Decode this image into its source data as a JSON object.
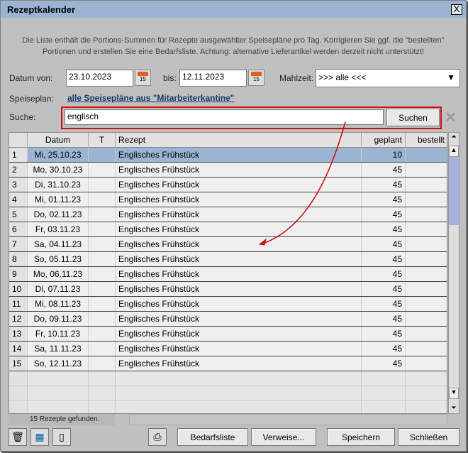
{
  "window": {
    "title": "Rezeptkalender",
    "close_label": "X"
  },
  "info": {
    "line1": "Die Liste enthält die Portions-Summen für Rezepte ausgewählter Speisepläne pro Tag. Korrigieren Sie ggf. die \"bestellten\"",
    "line2": "Portionen und erstellen Sie eine Bedarfsliste. Achtung: alternative Lieferartikel werden derzeit nicht unterstützt!"
  },
  "filter": {
    "von_label": "Datum von:",
    "von_value": "23.10.2023",
    "bis_label": "bis:",
    "bis_value": "12.11.2023",
    "cal_day": "15",
    "mahlzeit_label": "Mahlzeit:",
    "mahlzeit_value": ">>> alle <<<",
    "speiseplan_label": "Speiseplan:",
    "speiseplan_link": "alle Speisepläne aus \"Mitarbeiterkantine\"",
    "suche_label": "Suche:",
    "suche_value": "englisch",
    "suchen_label": "Suchen",
    "clear_label": "✕"
  },
  "table": {
    "headers": [
      "",
      "Datum",
      "T",
      "Rezept",
      "geplant",
      "bestellt"
    ],
    "rows": [
      [
        "1",
        "Mi, 25.10.23",
        "",
        "Englisches Frühstück",
        "10",
        ""
      ],
      [
        "2",
        "Mo, 30.10.23",
        "",
        "Englisches Frühstück",
        "45",
        ""
      ],
      [
        "3",
        "Di, 31.10.23",
        "",
        "Englisches Frühstück",
        "45",
        ""
      ],
      [
        "4",
        "Mi, 01.11.23",
        "",
        "Englisches Frühstück",
        "45",
        ""
      ],
      [
        "5",
        "Do, 02.11.23",
        "",
        "Englisches Frühstück",
        "45",
        ""
      ],
      [
        "6",
        "Fr, 03.11.23",
        "",
        "Englisches Frühstück",
        "45",
        ""
      ],
      [
        "7",
        "Sa, 04.11.23",
        "",
        "Englisches Frühstück",
        "45",
        ""
      ],
      [
        "8",
        "So, 05.11.23",
        "",
        "Englisches Frühstück",
        "45",
        ""
      ],
      [
        "9",
        "Mo, 06.11.23",
        "",
        "Englisches Frühstück",
        "45",
        ""
      ],
      [
        "10",
        "Di, 07.11.23",
        "",
        "Englisches Frühstück",
        "45",
        ""
      ],
      [
        "11",
        "Mi, 08.11.23",
        "",
        "Englisches Frühstück",
        "45",
        ""
      ],
      [
        "12",
        "Do, 09.11.23",
        "",
        "Englisches Frühstück",
        "45",
        ""
      ],
      [
        "13",
        "Fr, 10.11.23",
        "",
        "Englisches Frühstück",
        "45",
        ""
      ],
      [
        "14",
        "Sa, 11.11.23",
        "",
        "Englisches Frühstück",
        "45",
        ""
      ],
      [
        "15",
        "So, 12.11.23",
        "",
        "Englisches Frühstück",
        "45",
        ""
      ]
    ],
    "status": "15  Rezepte gefunden."
  },
  "buttons": {
    "bedarfsliste": "Bedarfsliste",
    "verweise": "Verweise...",
    "speichern": "Speichern",
    "schliessen": "Schließen"
  },
  "colors": {
    "selected": "#9ab4d2",
    "annotation": "#cc1111"
  }
}
